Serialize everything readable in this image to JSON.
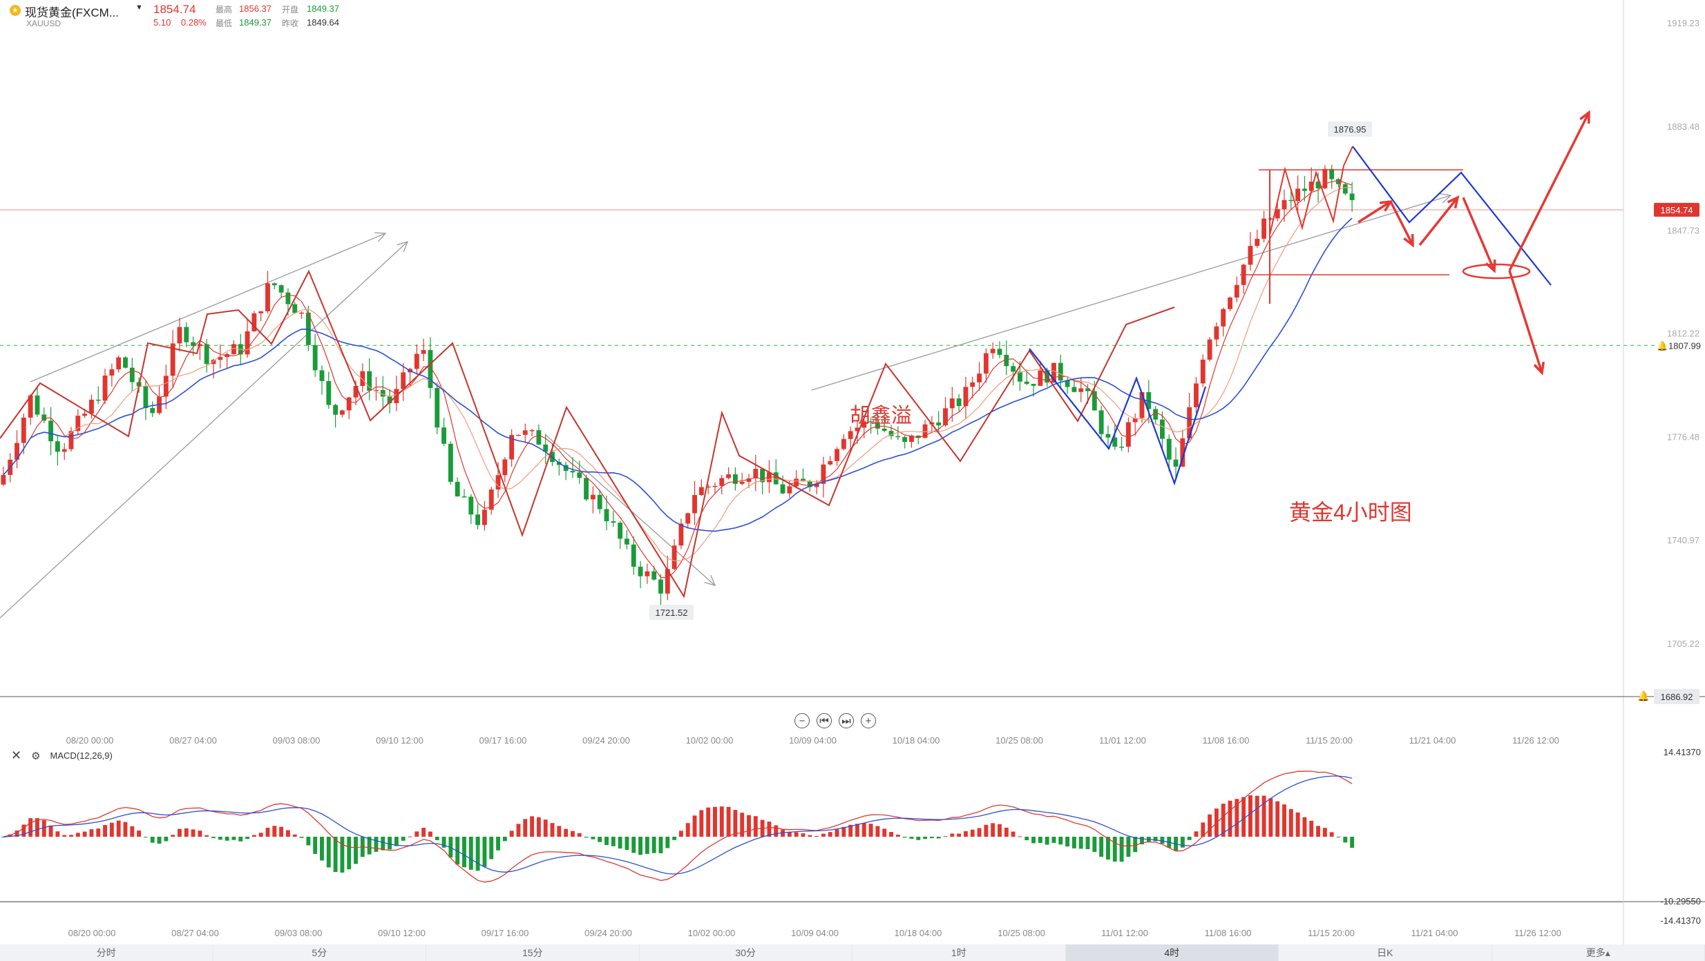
{
  "header": {
    "name": "现货黄金(FXCM...",
    "symbol": "XAUUSD",
    "price": "1854.74",
    "change": "5.10",
    "change_pct": "0.28%",
    "high_label": "最高",
    "high": "1856.37",
    "low_label": "最低",
    "low": "1849.37",
    "open_label": "开盘",
    "open": "1849.37",
    "prev_label": "昨收",
    "prev": "1849.64",
    "up_color": "#e0362f",
    "down_color": "#1a9b3a"
  },
  "annotations": {
    "author": "胡鑫溢",
    "chart_title": "黄金4小时图",
    "peak_label": "1876.95",
    "trough_label": "1721.52",
    "current_price_tag": "1854.74",
    "level_tag": "1807.99",
    "bottom_tag": "1686.92"
  },
  "macd": {
    "label": "MACD(12,26,9)",
    "top_value": "14.41370",
    "zero_value": "-10.29550",
    "bottom_value": "-14.41370"
  },
  "zoom_controls": [
    "−",
    "⏮",
    "⏭",
    "+"
  ],
  "tabs": [
    "分时",
    "5分",
    "15分",
    "30分",
    "1时",
    "4时",
    "日K",
    "更多▴"
  ],
  "active_tab": "4时",
  "chart_data": {
    "type": "candlestick",
    "y_axis_ticks": [
      "1919.23",
      "1883.48",
      "1847.73",
      "1812.22",
      "1776.48",
      "1740.97",
      "1705.22"
    ],
    "x_axis_ticks": [
      "08/20 00:00",
      "08/27 04:00",
      "09/03 08:00",
      "09/10 12:00",
      "09/17 16:00",
      "09/24 20:00",
      "10/02 00:00",
      "10/09 04:00",
      "10/18 04:00",
      "10/25 08:00",
      "11/01 12:00",
      "11/08 16:00",
      "11/15 20:00",
      "11/21 04:00",
      "11/26 12:00"
    ],
    "ylim": [
      1686.92,
      1925
    ],
    "close_path": [
      {
        "x": "08/20 00:00",
        "y": 1760
      },
      {
        "x": "08/22",
        "y": 1790
      },
      {
        "x": "08/25",
        "y": 1772
      },
      {
        "x": "08/27 04:00",
        "y": 1787
      },
      {
        "x": "08/29",
        "y": 1804
      },
      {
        "x": "09/01",
        "y": 1783
      },
      {
        "x": "09/02",
        "y": 1814
      },
      {
        "x": "09/03 08:00",
        "y": 1803
      },
      {
        "x": "09/05",
        "y": 1807
      },
      {
        "x": "09/06",
        "y": 1830
      },
      {
        "x": "09/08",
        "y": 1819
      },
      {
        "x": "09/10 12:00",
        "y": 1783
      },
      {
        "x": "09/12",
        "y": 1797
      },
      {
        "x": "09/14",
        "y": 1788
      },
      {
        "x": "09/15",
        "y": 1808
      },
      {
        "x": "09/17 16:00",
        "y": 1758
      },
      {
        "x": "09/19",
        "y": 1746
      },
      {
        "x": "09/21",
        "y": 1779
      },
      {
        "x": "09/22",
        "y": 1775
      },
      {
        "x": "09/24 20:00",
        "y": 1762
      },
      {
        "x": "09/27",
        "y": 1752
      },
      {
        "x": "09/29",
        "y": 1733
      },
      {
        "x": "09/30",
        "y": 1724
      },
      {
        "x": "10/02 00:00",
        "y": 1757
      },
      {
        "x": "10/05",
        "y": 1762
      },
      {
        "x": "10/07",
        "y": 1765
      },
      {
        "x": "10/09 04:00",
        "y": 1758
      },
      {
        "x": "10/12",
        "y": 1761
      },
      {
        "x": "10/15",
        "y": 1778
      },
      {
        "x": "10/18 04:00",
        "y": 1782
      },
      {
        "x": "10/20",
        "y": 1773
      },
      {
        "x": "10/22",
        "y": 1782
      },
      {
        "x": "10/25 08:00",
        "y": 1790
      },
      {
        "x": "10/27",
        "y": 1810
      },
      {
        "x": "10/28",
        "y": 1795
      },
      {
        "x": "10/30",
        "y": 1799
      },
      {
        "x": "11/01 12:00",
        "y": 1792
      },
      {
        "x": "11/03",
        "y": 1770
      },
      {
        "x": "11/04",
        "y": 1791
      },
      {
        "x": "11/05",
        "y": 1763
      },
      {
        "x": "11/08 16:00",
        "y": 1808
      },
      {
        "x": "11/09",
        "y": 1830
      },
      {
        "x": "11/10",
        "y": 1850
      },
      {
        "x": "11/12",
        "y": 1860
      },
      {
        "x": "11/15 20:00",
        "y": 1866
      },
      {
        "x": "11/16",
        "y": 1854.74
      }
    ],
    "macd_histogram_range": [
      -10.2955,
      14.4137
    ]
  }
}
